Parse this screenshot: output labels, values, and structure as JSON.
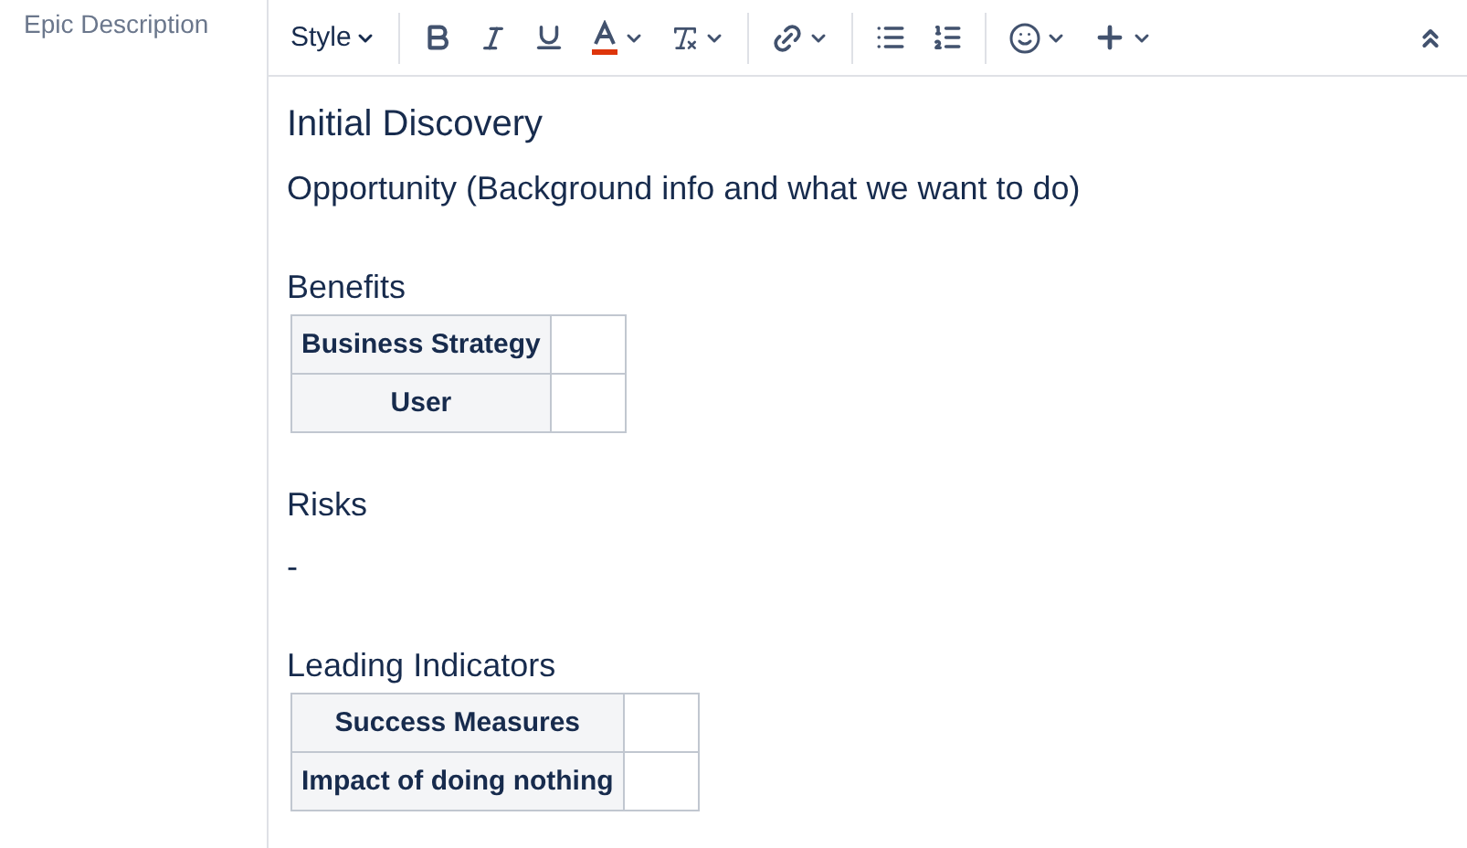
{
  "field_label": "Epic Description",
  "toolbar": [
    {
      "kind": "style",
      "label": "Style"
    },
    {
      "kind": "divider"
    },
    {
      "kind": "bold"
    },
    {
      "kind": "italic"
    },
    {
      "kind": "underline"
    },
    {
      "kind": "text-color",
      "color": "#de350b",
      "dropdown": true
    },
    {
      "kind": "clear-format",
      "dropdown": true
    },
    {
      "kind": "divider"
    },
    {
      "kind": "link",
      "dropdown": true
    },
    {
      "kind": "divider"
    },
    {
      "kind": "bullet-list"
    },
    {
      "kind": "numbered-list"
    },
    {
      "kind": "divider"
    },
    {
      "kind": "emoji",
      "dropdown": true
    },
    {
      "kind": "insert",
      "dropdown": true
    },
    {
      "kind": "collapse"
    }
  ],
  "content": [
    {
      "kind": "heading",
      "text": "Initial Discovery"
    },
    {
      "kind": "subheading",
      "text": "Opportunity (Background info and what we want to do)"
    },
    {
      "kind": "blank"
    },
    {
      "kind": "subheading",
      "text": "Benefits"
    },
    {
      "kind": "table",
      "rows": [
        {
          "header": "Business Strategy"
        },
        {
          "header": "User"
        }
      ]
    },
    {
      "kind": "blank"
    },
    {
      "kind": "subheading",
      "text": "Risks"
    },
    {
      "kind": "paragraph",
      "text": "-"
    },
    {
      "kind": "blank"
    },
    {
      "kind": "subheading",
      "text": "Leading Indicators"
    },
    {
      "kind": "table",
      "rows": [
        {
          "header": "Success Measures"
        },
        {
          "header": "Impact of doing nothing"
        }
      ]
    }
  ]
}
